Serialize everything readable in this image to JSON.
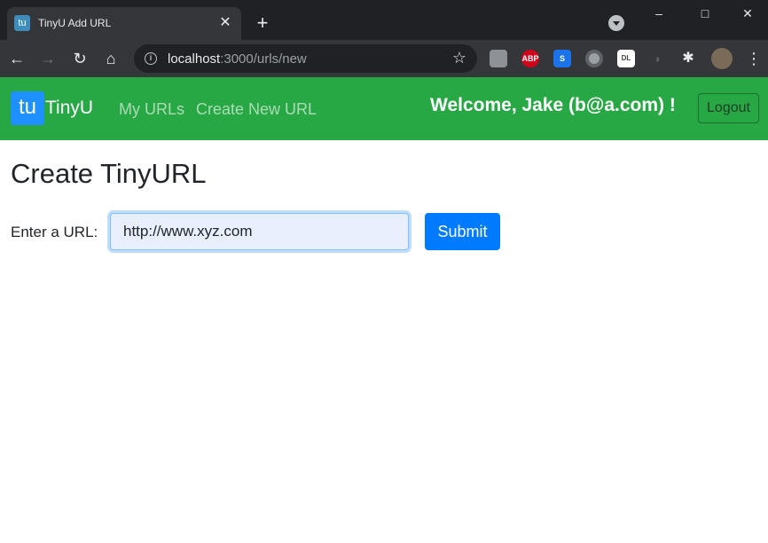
{
  "browser": {
    "tab": {
      "title": "TinyU Add URL",
      "favicon_text": "tu",
      "close_icon": "close-icon"
    },
    "new_tab_symbol": "+",
    "window_controls": {
      "minimize": "–",
      "maximize": "□",
      "close": "✕"
    },
    "nav": {
      "back": "←",
      "forward": "→",
      "reload": "↻",
      "home": "⌂"
    },
    "address": {
      "host": "localhost",
      "path": ":3000/urls/new"
    },
    "star": "☆",
    "extensions": [
      {
        "name": "extension-1",
        "label": "",
        "color": "#8e9196"
      },
      {
        "name": "adblock-plus",
        "label": "ABP",
        "color": "#d0021b"
      },
      {
        "name": "extension-s",
        "label": "S",
        "color": "#1a73e8"
      },
      {
        "name": "extension-circle",
        "label": "",
        "color": "#9aa0a6"
      },
      {
        "name": "extension-zoom-dl",
        "label": "DL",
        "color": "#ffffff"
      },
      {
        "name": "extension-mouse",
        "label": "",
        "color": "#35363a"
      },
      {
        "name": "extensions-puzzle",
        "label": "",
        "color": "#35363a"
      }
    ],
    "menu": "⋮"
  },
  "navbar": {
    "brand_logo": "tu",
    "brand_text": "TinyU",
    "links": [
      "My URLs",
      "Create New URL"
    ],
    "welcome": "Welcome, Jake (b@a.com) !",
    "logout": "Logout",
    "bg_color": "#28a745"
  },
  "main": {
    "title": "Create TinyURL",
    "form": {
      "label": "Enter a URL:",
      "input_value": "http://www.xyz.com",
      "submit": "Submit"
    }
  }
}
